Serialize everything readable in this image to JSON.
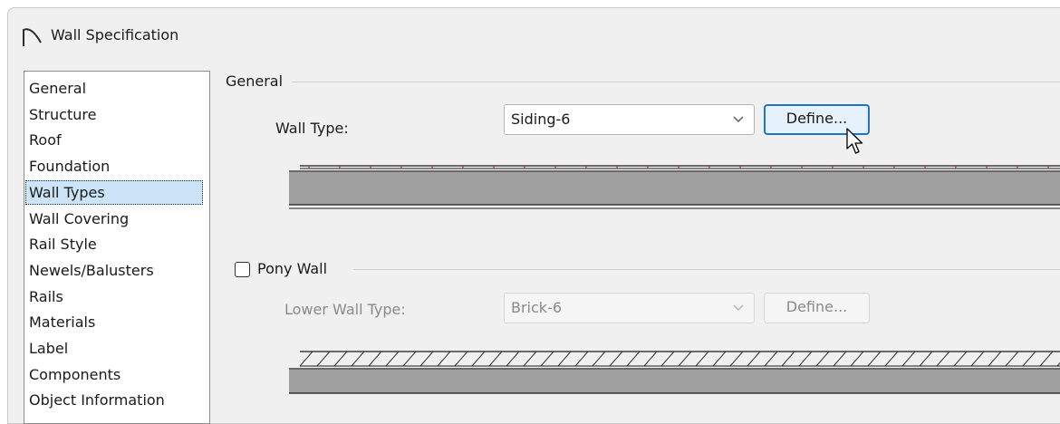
{
  "window": {
    "title": "Wall Specification",
    "icon": "arch-icon"
  },
  "categories": [
    {
      "label": "General",
      "selected": false
    },
    {
      "label": "Structure",
      "selected": false
    },
    {
      "label": "Roof",
      "selected": false
    },
    {
      "label": "Foundation",
      "selected": false
    },
    {
      "label": "Wall Types",
      "selected": true
    },
    {
      "label": "Wall Covering",
      "selected": false
    },
    {
      "label": "Rail Style",
      "selected": false
    },
    {
      "label": "Newels/Balusters",
      "selected": false
    },
    {
      "label": "Rails",
      "selected": false
    },
    {
      "label": "Materials",
      "selected": false
    },
    {
      "label": "Label",
      "selected": false
    },
    {
      "label": "Components",
      "selected": false
    },
    {
      "label": "Object Information",
      "selected": false
    }
  ],
  "general": {
    "group_label": "General",
    "wall_type_label": "Wall Type:",
    "wall_type_value": "Siding-6",
    "define_label": "Define..."
  },
  "pony_wall": {
    "checkbox_label": "Pony Wall",
    "checked": false,
    "lower_wall_type_label": "Lower Wall Type:",
    "lower_wall_type_value": "Brick-6",
    "define_label": "Define..."
  },
  "colors": {
    "accent": "#1f73c9",
    "selection": "#cce4f7",
    "wall_fill": "#a0a0a0",
    "siding_marks": "#9b3b8f"
  }
}
